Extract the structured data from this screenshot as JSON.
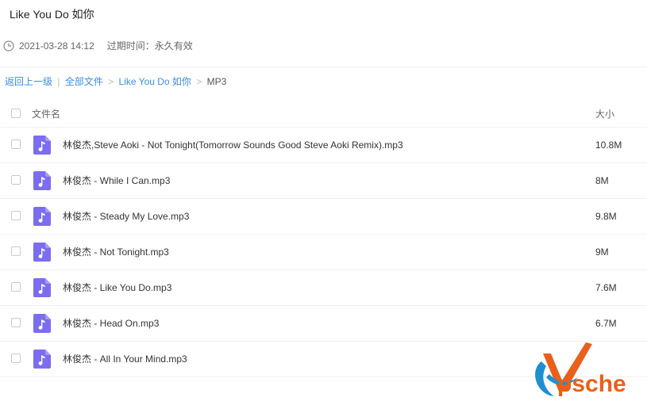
{
  "share": {
    "title": "Like You Do 如你",
    "created": "2021-03-28 14:12",
    "expire_label": "过期时间：",
    "expire_value": "永久有效"
  },
  "breadcrumb": {
    "back": "返回上一级",
    "divider": "|",
    "all_files": "全部文件",
    "sep": ">",
    "folder": "Like You Do 如你",
    "current": "MP3"
  },
  "list": {
    "col_name": "文件名",
    "col_size": "大小",
    "files": [
      {
        "name": "林俊杰,Steve Aoki - Not Tonight(Tomorrow Sounds Good Steve Aoki Remix).mp3",
        "size": "10.8M"
      },
      {
        "name": "林俊杰 - While I Can.mp3",
        "size": "8M"
      },
      {
        "name": "林俊杰 - Steady My Love.mp3",
        "size": "9.8M"
      },
      {
        "name": "林俊杰 - Not Tonight.mp3",
        "size": "9M"
      },
      {
        "name": "林俊杰 - Like You Do.mp3",
        "size": "7.6M"
      },
      {
        "name": "林俊杰 - Head On.mp3",
        "size": "6.7M"
      },
      {
        "name": "林俊杰 - All In Your Mind.mp3",
        "size": ""
      }
    ]
  },
  "watermark": {
    "text": "psche"
  },
  "icons": {
    "clock": "clock-icon",
    "file": "music-file-icon"
  },
  "colors": {
    "link": "#3a8ee6",
    "file_icon": "#7b6cf0",
    "watermark_orange": "#e8601c",
    "watermark_blue": "#1e8fd0"
  }
}
